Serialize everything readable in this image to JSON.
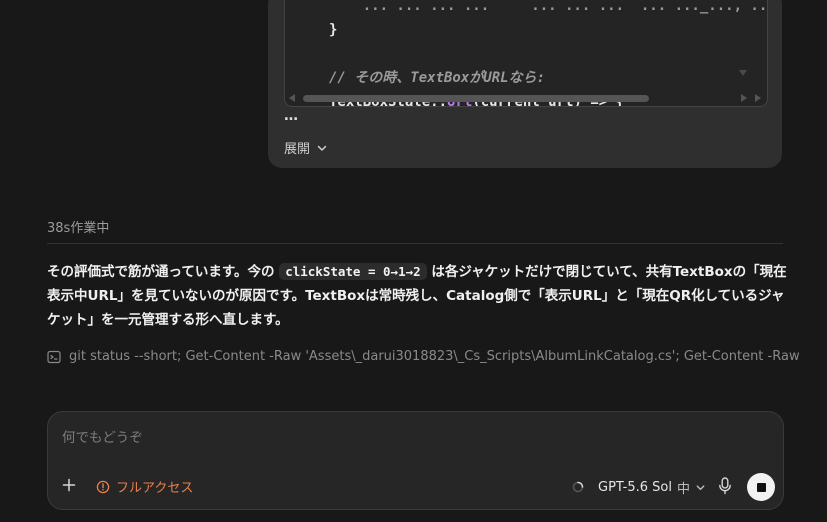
{
  "code_block": {
    "lines": [
      {
        "kind": "partial",
        "text": "    ... ... ... ...     ... ... ...  ... ..._..., ... ... ... ..."
      },
      {
        "kind": "plain",
        "text": "}"
      },
      {
        "kind": "blank",
        "text": ""
      },
      {
        "kind": "comment",
        "text": "// その時、TextBoxがURLなら:"
      },
      {
        "kind": "code",
        "prefix": "TextBoxState::",
        "keyword": "Url",
        "suffix": "(current url) => {"
      }
    ]
  },
  "ellipsis": "…",
  "expand_label": "展開",
  "status_text": "38s作業中",
  "message": {
    "part1": "その評価式で筋が通っています。今の ",
    "inline_code": "clickState = 0→1→2",
    "part2": " は各ジャケットだけで閉じていて、共有TextBoxの「現在表示中URL」を見ていないのが原因です。TextBoxは常時残し、Catalog側で「表示URL」と「現在QR化しているジャケット」を一元管理する形へ直します。"
  },
  "command": {
    "icon": "terminal-icon",
    "text": "git status --short; Get-Content -Raw 'Assets\\_darui3018823\\_Cs_Scripts\\AlbumLinkCatalog.cs'; Get-Content -Raw"
  },
  "composer": {
    "placeholder": "何でもどうぞ",
    "access_label": "フルアクセス",
    "model_label": "GPT-5.6 Sol",
    "effort_label": "中"
  },
  "colors": {
    "background": "#181818",
    "accent_access": "#e8804a",
    "keyword": "#b57be6"
  }
}
